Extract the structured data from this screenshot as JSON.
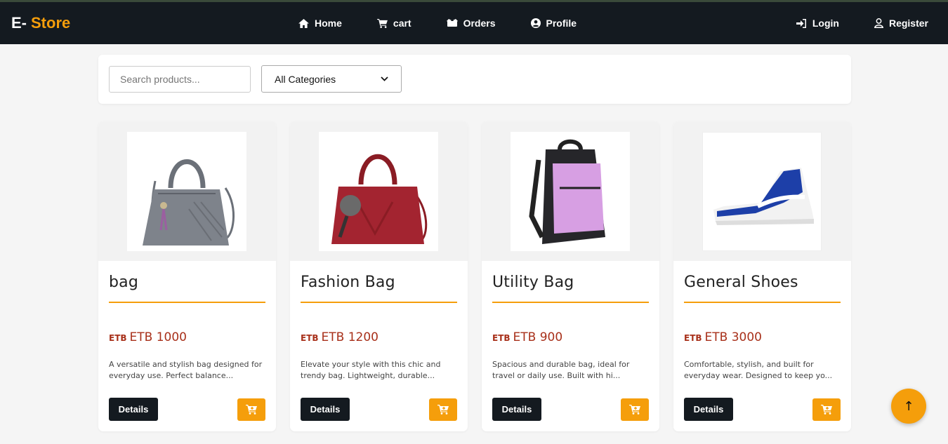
{
  "brand": {
    "prefix": "E-",
    "name": "Store"
  },
  "nav": {
    "center": [
      {
        "label": "Home",
        "icon": "home-icon"
      },
      {
        "label": "cart",
        "icon": "cart-icon"
      },
      {
        "label": "Orders",
        "icon": "orders-icon"
      },
      {
        "label": "Profile",
        "icon": "user-circle-icon"
      }
    ],
    "right": [
      {
        "label": "Login",
        "icon": "login-icon"
      },
      {
        "label": "Register",
        "icon": "user-icon"
      }
    ]
  },
  "filters": {
    "search_placeholder": "Search products...",
    "category_selected": "All Categories"
  },
  "products": [
    {
      "name": "bag",
      "currency": "ETB",
      "price": "ETB 1000",
      "description": "A versatile and stylish bag designed for everyday use. Perfect balance...",
      "details_label": "Details",
      "image": "grey handbag"
    },
    {
      "name": "Fashion Bag",
      "currency": "ETB",
      "price": "ETB 1200",
      "description": "Elevate your style with this chic and trendy bag. Lightweight, durable...",
      "details_label": "Details",
      "image": "red handbag"
    },
    {
      "name": "Utility Bag",
      "currency": "ETB",
      "price": "ETB 900",
      "description": "Spacious and durable bag, ideal for travel or daily use. Built with hi...",
      "details_label": "Details",
      "image": "pink backpack"
    },
    {
      "name": "General Shoes",
      "currency": "ETB",
      "price": "ETB 3000",
      "description": "Comfortable, stylish, and built for everyday wear. Designed to keep yo...",
      "details_label": "Details",
      "image": "blue sneaker"
    }
  ],
  "scroll_top_symbol": "↑",
  "colors": {
    "accent": "#f59e0b",
    "nav_bg": "#141a20",
    "price": "#a8301a"
  }
}
